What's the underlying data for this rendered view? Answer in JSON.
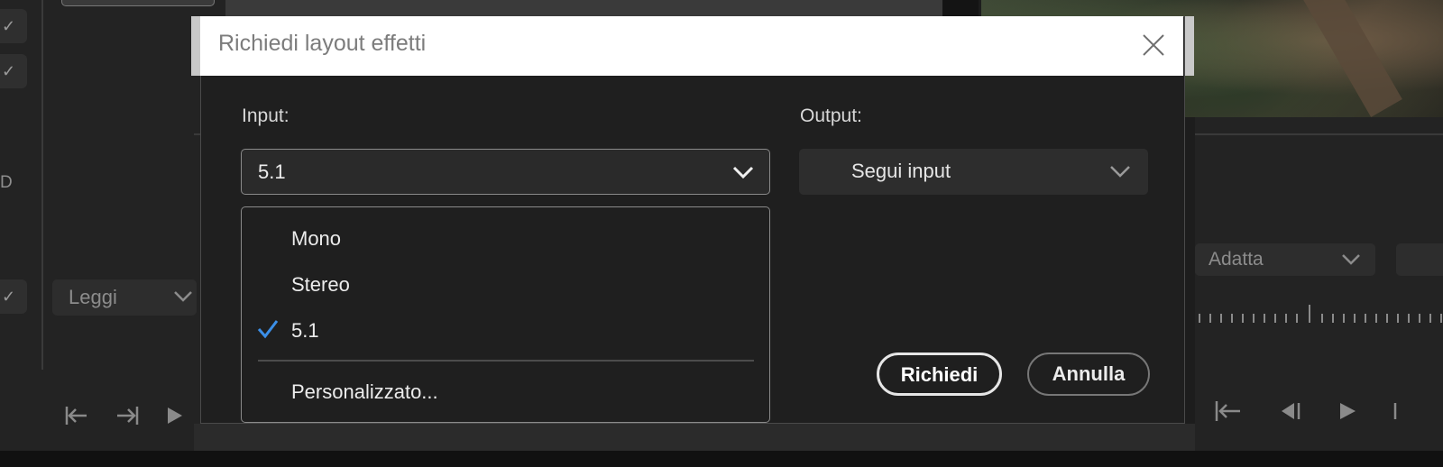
{
  "background": {
    "left_panel": {
      "d_letter": "D",
      "leggi_label": "Leggi"
    },
    "right_panel": {
      "adatta_label": "Adatta"
    }
  },
  "dialog": {
    "title": "Richiedi layout effetti",
    "input_label": "Input:",
    "output_label": "Output:",
    "input_value": "5.1",
    "output_value": "Segui input",
    "menu_items": [
      {
        "label": "Mono",
        "checked": false
      },
      {
        "label": "Stereo",
        "checked": false
      },
      {
        "label": "5.1",
        "checked": true
      },
      {
        "label": "Personalizzato...",
        "checked": false
      }
    ],
    "ok_label": "Richiedi",
    "cancel_label": "Annulla"
  },
  "colors": {
    "check_accent": "#3b8fe8",
    "titlebar": "#ffffff",
    "dialog_bg": "#1f1f1f"
  }
}
